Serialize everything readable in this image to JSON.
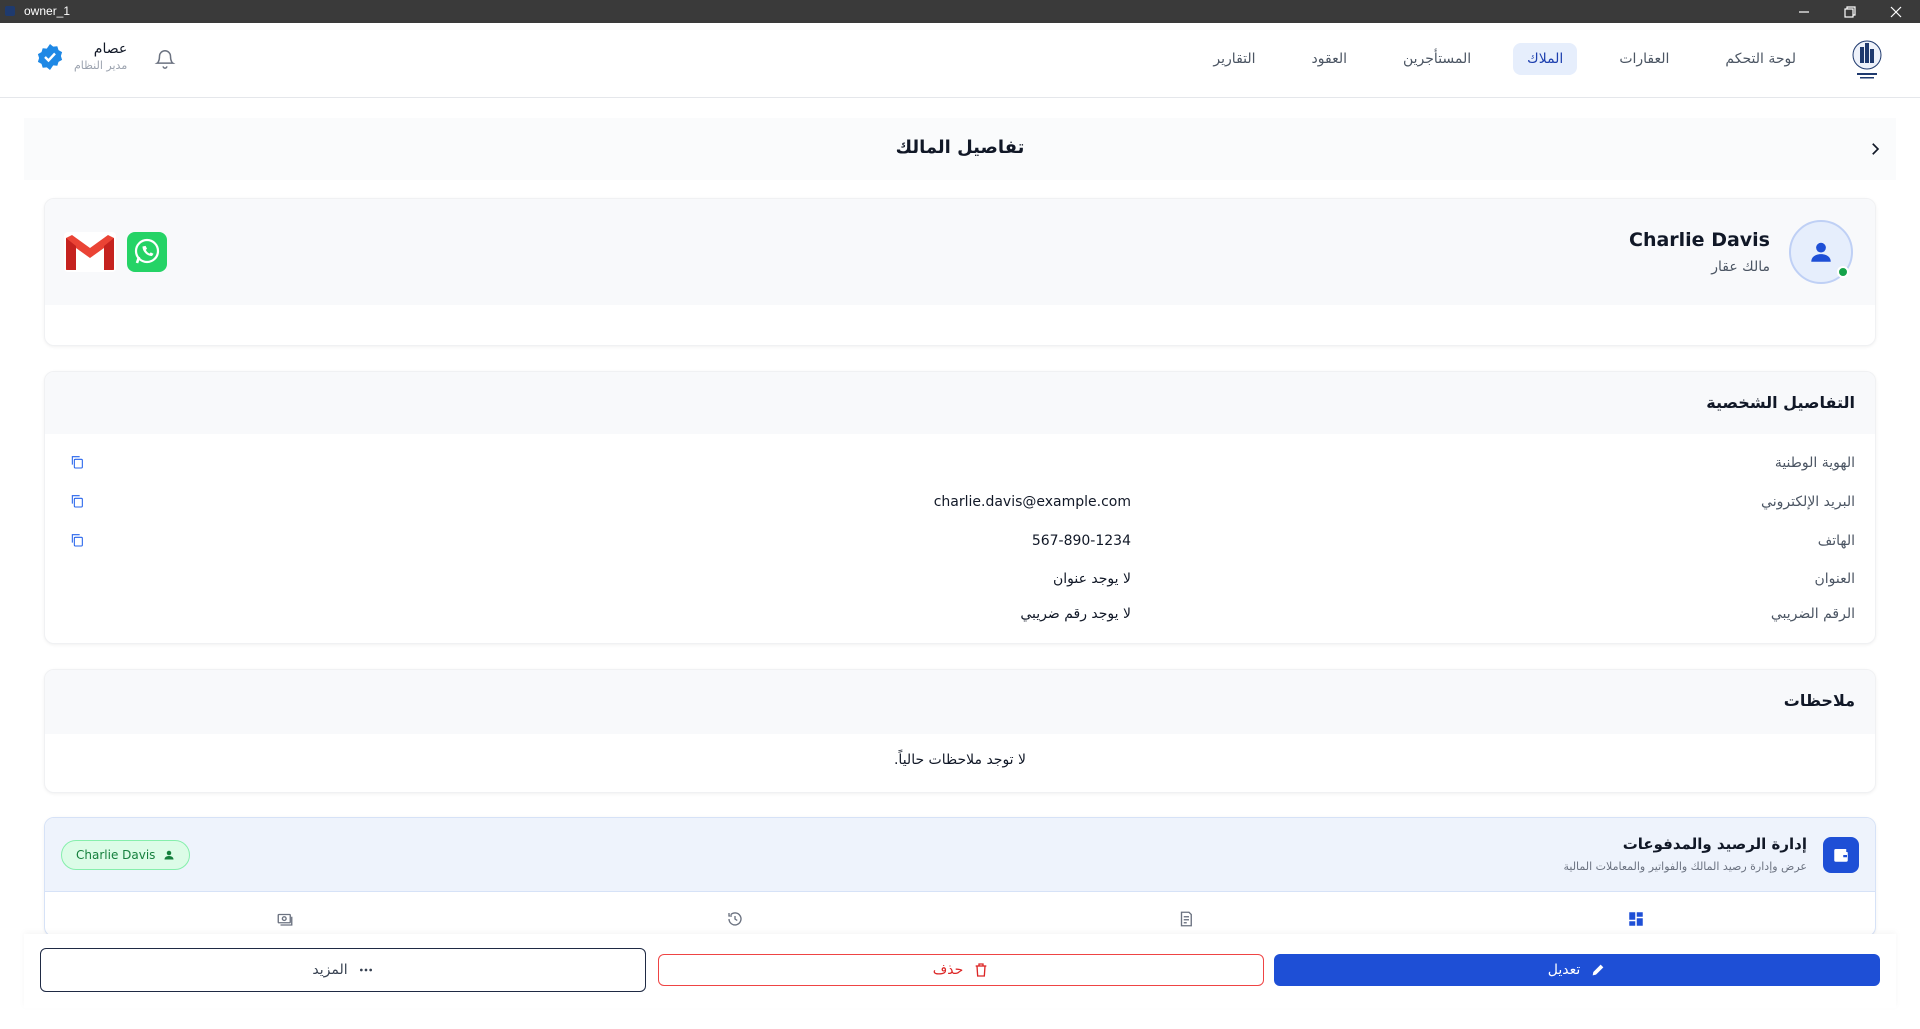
{
  "window": {
    "title": "owner_1"
  },
  "nav": {
    "items": [
      {
        "label": "لوحة التحكم",
        "active": false
      },
      {
        "label": "العقارات",
        "active": false
      },
      {
        "label": "الملاك",
        "active": true
      },
      {
        "label": "المستأجرين",
        "active": false
      },
      {
        "label": "العقود",
        "active": false
      },
      {
        "label": "التقارير",
        "active": false
      }
    ],
    "user": {
      "name": "عصام",
      "role": "مدير النظام"
    }
  },
  "page": {
    "title": "تفاصيل المالك"
  },
  "profile": {
    "name": "Charlie Davis",
    "role": "مالك عقار",
    "status": "online"
  },
  "personal_details": {
    "title": "التفاصيل الشخصية",
    "rows": [
      {
        "label": "الهوية الوطنية",
        "value": ""
      },
      {
        "label": "البريد الإلكتروني",
        "value": "charlie.davis@example.com"
      },
      {
        "label": "الهاتف",
        "value": "567-890-1234"
      },
      {
        "label": "العنوان",
        "value": "لا يوجد عنوان"
      },
      {
        "label": "الرقم الضريبي",
        "value": "لا يوجد رقم ضريبي"
      }
    ]
  },
  "notes": {
    "title": "ملاحظات",
    "empty_text": "لا توجد ملاحظات حالياً."
  },
  "balance": {
    "title": "إدارة الرصيد والمدفوعات",
    "subtitle": "عرض وإدارة رصيد المالك والفواتير والمعاملات المالية",
    "owner_chip": "Charlie Davis"
  },
  "actions": {
    "edit_label": "تعديل",
    "delete_label": "حذف",
    "more_label": "المزيد"
  },
  "colors": {
    "primary": "#1e4fd6",
    "danger": "#dc2626",
    "success": "#16a34a",
    "active_nav_bg": "#e6eefc"
  }
}
